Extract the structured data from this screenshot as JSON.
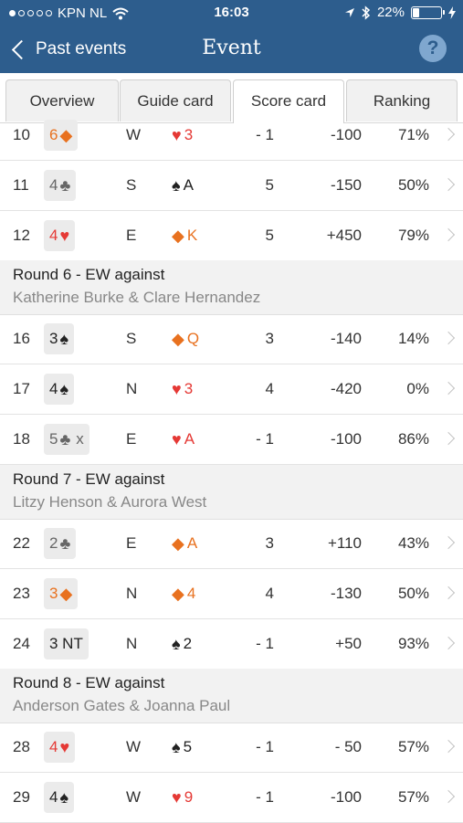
{
  "status": {
    "carrier": "KPN NL",
    "time": "16:03",
    "battery": "22%",
    "battery_level": 0.22
  },
  "nav": {
    "back_label": "Past events",
    "title": "Event",
    "help_icon": "?"
  },
  "tabs": [
    {
      "label": "Overview"
    },
    {
      "label": "Guide card"
    },
    {
      "label": "Score card"
    },
    {
      "label": "Ranking"
    }
  ],
  "rows": [
    {
      "num": "10",
      "level": "6",
      "suit": "di",
      "extra": "",
      "declarer": "W",
      "lead_suit": "he",
      "lead": "3",
      "tricks": "- 1",
      "score": "-100",
      "pct": "71%"
    },
    {
      "num": "11",
      "level": "4",
      "suit": "cl",
      "extra": "",
      "declarer": "S",
      "lead_suit": "sp",
      "lead": "A",
      "tricks": "5",
      "score": "-150",
      "pct": "50%"
    },
    {
      "num": "12",
      "level": "4",
      "suit": "he",
      "extra": "",
      "declarer": "E",
      "lead_suit": "di",
      "lead": "K",
      "tricks": "5",
      "score": "+450",
      "pct": "79%"
    },
    {
      "num": "16",
      "level": "3",
      "suit": "sp",
      "extra": "",
      "declarer": "S",
      "lead_suit": "di",
      "lead": "Q",
      "tricks": "3",
      "score": "-140",
      "pct": "14%"
    },
    {
      "num": "17",
      "level": "4",
      "suit": "sp",
      "extra": "",
      "declarer": "N",
      "lead_suit": "he",
      "lead": "3",
      "tricks": "4",
      "score": "-420",
      "pct": "0%"
    },
    {
      "num": "18",
      "level": "5",
      "suit": "cl",
      "extra": "x",
      "declarer": "E",
      "lead_suit": "he",
      "lead": "A",
      "tricks": "- 1",
      "score": "-100",
      "pct": "86%"
    },
    {
      "num": "22",
      "level": "2",
      "suit": "cl",
      "extra": "",
      "declarer": "E",
      "lead_suit": "di",
      "lead": "A",
      "tricks": "3",
      "score": "+110",
      "pct": "43%"
    },
    {
      "num": "23",
      "level": "3",
      "suit": "di",
      "extra": "",
      "declarer": "N",
      "lead_suit": "di",
      "lead": "4",
      "tricks": "4",
      "score": "-130",
      "pct": "50%"
    },
    {
      "num": "24",
      "level": "3 NT",
      "suit": "",
      "extra": "",
      "declarer": "N",
      "lead_suit": "sp",
      "lead": "2",
      "tricks": "- 1",
      "score": "+50",
      "pct": "93%"
    },
    {
      "num": "28",
      "level": "4",
      "suit": "he",
      "extra": "",
      "declarer": "W",
      "lead_suit": "sp",
      "lead": "5",
      "tricks": "- 1",
      "score": "- 50",
      "pct": "57%"
    },
    {
      "num": "29",
      "level": "4",
      "suit": "sp",
      "extra": "",
      "declarer": "W",
      "lead_suit": "he",
      "lead": "9",
      "tricks": "- 1",
      "score": "-100",
      "pct": "57%"
    }
  ],
  "rounds": [
    {
      "title": "Round  6 - EW  against",
      "opponents": "Katherine Burke & Clare Hernandez"
    },
    {
      "title": "Round  7 - EW  against",
      "opponents": "Litzy Henson & Aurora West"
    },
    {
      "title": "Round  8 - EW  against",
      "opponents": "Anderson Gates & Joanna Paul"
    }
  ]
}
